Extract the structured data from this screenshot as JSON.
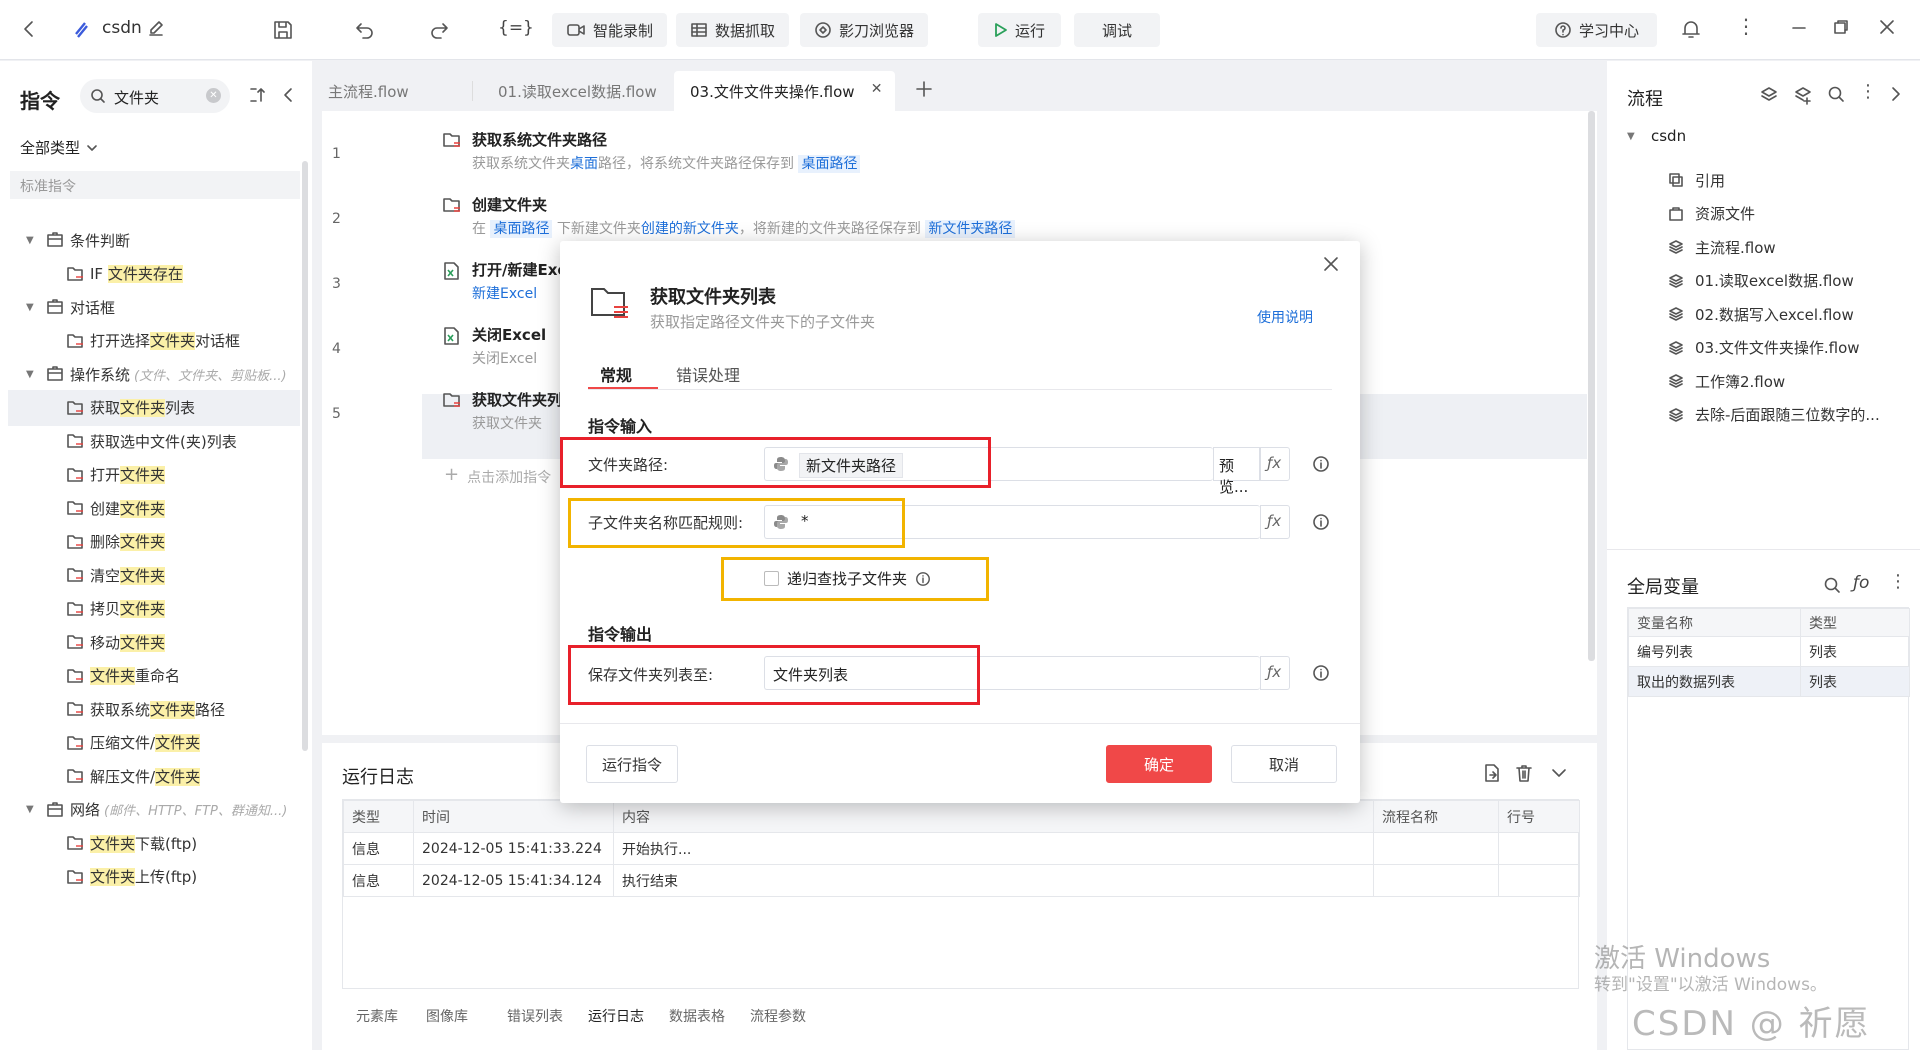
{
  "topbar": {
    "project": "csdn",
    "record": "智能录制",
    "grab": "数据抓取",
    "browser": "影刀浏览器",
    "run": "运行",
    "debug": "调试",
    "learn": "学习中心"
  },
  "left": {
    "title": "指令",
    "search_value": "文件夹",
    "filter": "全部类型",
    "section": "标准指令",
    "items": [
      {
        "pre": "",
        "hl": "",
        "post": "条件判断",
        "level": 0
      },
      {
        "pre": "IF ",
        "hl": "文件夹存在",
        "post": "",
        "level": 1
      },
      {
        "pre": "",
        "hl": "",
        "post": "对话框",
        "level": 0
      },
      {
        "pre": "打开选择",
        "hl": "文件夹",
        "post": "对话框",
        "level": 1
      },
      {
        "pre": "",
        "hl": "",
        "post": "操作系统",
        "level": 0,
        "note": "(文件、文件夹、剪贴板...)"
      },
      {
        "pre": "获取",
        "hl": "文件夹",
        "post": "列表",
        "level": 1
      },
      {
        "pre": "获取选中文件(夹)列表",
        "hl": "",
        "post": "",
        "level": 1
      },
      {
        "pre": "打开",
        "hl": "文件夹",
        "post": "",
        "level": 1
      },
      {
        "pre": "创建",
        "hl": "文件夹",
        "post": "",
        "level": 1
      },
      {
        "pre": "删除",
        "hl": "文件夹",
        "post": "",
        "level": 1
      },
      {
        "pre": "清空",
        "hl": "文件夹",
        "post": "",
        "level": 1
      },
      {
        "pre": "拷贝",
        "hl": "文件夹",
        "post": "",
        "level": 1
      },
      {
        "pre": "移动",
        "hl": "文件夹",
        "post": "",
        "level": 1
      },
      {
        "pre": "",
        "hl": "文件夹",
        "post": "重命名",
        "level": 1
      },
      {
        "pre": "获取系统",
        "hl": "文件夹",
        "post": "路径",
        "level": 1
      },
      {
        "pre": "压缩文件/",
        "hl": "文件夹",
        "post": "",
        "level": 1
      },
      {
        "pre": "解压文件/",
        "hl": "文件夹",
        "post": "",
        "level": 1
      },
      {
        "pre": "",
        "hl": "",
        "post": "网络",
        "level": 0,
        "note": "(邮件、HTTP、FTP、群通知...)"
      },
      {
        "pre": "",
        "hl": "文件夹",
        "post": "下载(ftp)",
        "level": 1
      },
      {
        "pre": "",
        "hl": "文件夹",
        "post": "上传(ftp)",
        "level": 1
      }
    ]
  },
  "tabs": [
    "主流程.flow",
    "01.读取excel数据.flow",
    "03.文件文件夹操作.flow"
  ],
  "steps": [
    {
      "no": "1",
      "title": "获取系统文件夹路径",
      "d1": "获取系统文件夹",
      "d2": "桌面",
      "d3": "路径，将系统文件夹路径保存到",
      "tag": "桌面路径"
    },
    {
      "no": "2",
      "title": "创建文件夹",
      "d1": "在",
      "tag1": "桌面路径",
      "d2": "下新建文件夹",
      "d3": "创建的新文件夹",
      "d4": "，将新建的文件夹路径保存到",
      "tag2": "新文件夹路径"
    },
    {
      "no": "3",
      "title": "打开/新建Exc",
      "d1": "新建Excel"
    },
    {
      "no": "4",
      "title": "关闭Excel",
      "d1": "关闭Excel"
    },
    {
      "no": "5",
      "title": "获取文件夹列",
      "d1": "获取文件夹"
    }
  ],
  "add_step": "点击添加指令",
  "dialog": {
    "title": "获取文件夹列表",
    "subtitle": "获取指定路径文件夹下的子文件夹",
    "help": "使用说明",
    "tab_general": "常规",
    "tab_error": "错误处理",
    "sec_input": "指令输入",
    "sec_output": "指令输出",
    "path_label": "文件夹路径:",
    "path_value": "新文件夹路径",
    "preview": "预览...",
    "rule_label": "子文件夹名称匹配规则:",
    "rule_value": "*",
    "recursive": "递归查找子文件夹",
    "save_label": "保存文件夹列表至:",
    "save_value": "文件夹列表",
    "run": "运行指令",
    "ok": "确定",
    "cancel": "取消"
  },
  "log": {
    "title": "运行日志",
    "headers": [
      "类型",
      "时间",
      "内容",
      "流程名称",
      "行号"
    ],
    "rows": [
      [
        "信息",
        "2024-12-05 15:41:33.224",
        "开始执行...",
        "",
        ""
      ],
      [
        "信息",
        "2024-12-05 15:41:34.124",
        "执行结束",
        "",
        ""
      ]
    ],
    "bottom_tabs": [
      "元素库",
      "图像库",
      "错误列表",
      "运行日志",
      "数据表格",
      "流程参数"
    ]
  },
  "right": {
    "title": "流程",
    "root": "csdn",
    "items": [
      "引用",
      "资源文件",
      "主流程.flow",
      "01.读取excel数据.flow",
      "02.数据写入excel.flow",
      "03.文件文件夹操作.flow",
      "工作簿2.flow",
      "去除-后面跟随三位数字的..."
    ],
    "globals_title": "全局变量",
    "var_headers": [
      "变量名称",
      "类型"
    ],
    "vars": [
      [
        "编号列表",
        "列表"
      ],
      [
        "取出的数据列表",
        "列表"
      ]
    ]
  },
  "watermark": {
    "line1": "激活 Windows",
    "line2": "转到\"设置\"以激活 Windows。",
    "csdn": "CSDN @ 祈愿"
  },
  "colors": {
    "accent": "#1e6fd9",
    "danger": "#f04848",
    "highlight": "#fbf0a8"
  }
}
